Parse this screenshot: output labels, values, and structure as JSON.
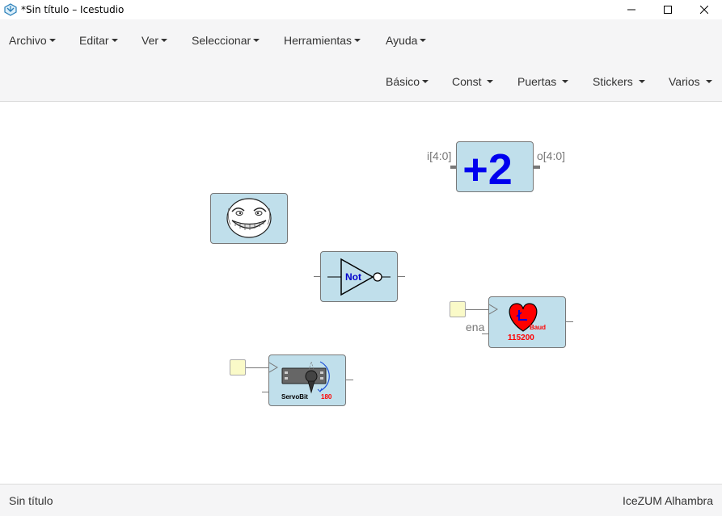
{
  "window": {
    "title": "*Sin título – Icestudio",
    "icons": {
      "app": "icestudio-logo-icon",
      "minimize": "minimize-icon",
      "maximize": "maximize-icon",
      "close": "close-icon"
    }
  },
  "menu": {
    "archivo": "Archivo",
    "editar": "Editar",
    "ver": "Ver",
    "seleccionar": "Seleccionar",
    "herramientas": "Herramientas",
    "ayuda": "Ayuda"
  },
  "toolbar": {
    "basico": "Básico",
    "const": "Const",
    "puertas": "Puertas",
    "stickers": "Stickers",
    "varios": "Varios"
  },
  "blocks": {
    "plus2": {
      "label": "+2",
      "input": "i[4:0]",
      "output": "o[4:0]"
    },
    "troll": {
      "icon": "trollface-icon"
    },
    "not": {
      "label": "Not"
    },
    "serial": {
      "label_ena": "ena",
      "baud_label": "Baud",
      "baud_value": "115200"
    },
    "servo": {
      "label": "ServoBit",
      "angle": "180"
    }
  },
  "status": {
    "left": "Sin título",
    "right": "IceZUM Alhambra"
  },
  "colors": {
    "block_fill": "#c0dfeb",
    "plus2_text": "#0000ee",
    "not_text": "#0000cc",
    "heart": "#ff0000",
    "input_fill": "#fafac8"
  }
}
